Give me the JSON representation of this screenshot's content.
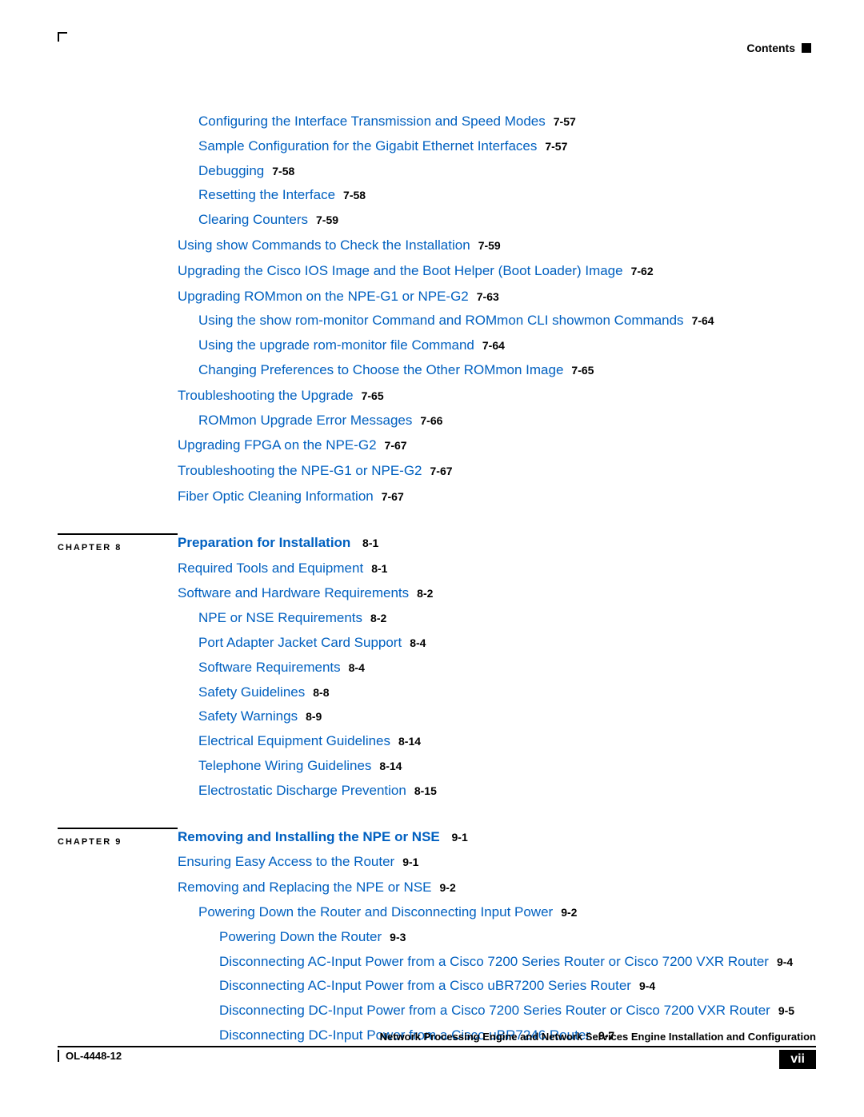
{
  "header": {
    "label": "Contents"
  },
  "section1": {
    "items": [
      {
        "indent": 1,
        "gap": false,
        "text": "Configuring the Interface Transmission and Speed Modes",
        "page": "7-57"
      },
      {
        "indent": 1,
        "gap": false,
        "text": "Sample Configuration for the Gigabit Ethernet Interfaces",
        "page": "7-57"
      },
      {
        "indent": 1,
        "gap": false,
        "text": "Debugging",
        "page": "7-58"
      },
      {
        "indent": 1,
        "gap": false,
        "text": "Resetting the Interface",
        "page": "7-58"
      },
      {
        "indent": 1,
        "gap": false,
        "text": "Clearing Counters",
        "page": "7-59"
      },
      {
        "indent": 0,
        "gap": true,
        "text": "Using show Commands to Check the Installation",
        "page": "7-59"
      },
      {
        "indent": 0,
        "gap": true,
        "text": "Upgrading the Cisco IOS Image and the Boot Helper (Boot Loader) Image",
        "page": "7-62"
      },
      {
        "indent": 0,
        "gap": true,
        "text": "Upgrading ROMmon on the NPE-G1 or NPE-G2",
        "page": "7-63"
      },
      {
        "indent": 1,
        "gap": false,
        "text": "Using the show rom-monitor Command and ROMmon CLI showmon Commands",
        "page": "7-64"
      },
      {
        "indent": 1,
        "gap": false,
        "text": "Using the upgrade rom-monitor file Command",
        "page": "7-64"
      },
      {
        "indent": 1,
        "gap": false,
        "text": "Changing Preferences to Choose the Other ROMmon Image",
        "page": "7-65"
      },
      {
        "indent": 0,
        "gap": true,
        "text": "Troubleshooting the Upgrade",
        "page": "7-65"
      },
      {
        "indent": 1,
        "gap": false,
        "text": "ROMmon Upgrade Error Messages",
        "page": "7-66"
      },
      {
        "indent": 0,
        "gap": true,
        "text": "Upgrading FPGA on the NPE-G2",
        "page": "7-67"
      },
      {
        "indent": 0,
        "gap": true,
        "text": "Troubleshooting the NPE-G1 or NPE-G2",
        "page": "7-67"
      },
      {
        "indent": 0,
        "gap": true,
        "text": "Fiber Optic Cleaning Information",
        "page": "7-67"
      }
    ]
  },
  "chapter8": {
    "chapter_label": "CHAPTER 8",
    "title": "Preparation for Installation",
    "title_page": "8-1",
    "items": [
      {
        "indent": 0,
        "gap": true,
        "text": "Required Tools and Equipment",
        "page": "8-1"
      },
      {
        "indent": 0,
        "gap": true,
        "text": "Software and Hardware Requirements",
        "page": "8-2"
      },
      {
        "indent": 1,
        "gap": false,
        "text": "NPE or NSE Requirements",
        "page": "8-2"
      },
      {
        "indent": 1,
        "gap": false,
        "text": "Port Adapter Jacket Card Support",
        "page": "8-4"
      },
      {
        "indent": 1,
        "gap": false,
        "text": "Software Requirements",
        "page": "8-4"
      },
      {
        "indent": 1,
        "gap": false,
        "text": "Safety Guidelines",
        "page": "8-8"
      },
      {
        "indent": 1,
        "gap": false,
        "text": "Safety Warnings",
        "page": "8-9"
      },
      {
        "indent": 1,
        "gap": false,
        "text": "Electrical Equipment Guidelines",
        "page": "8-14"
      },
      {
        "indent": 1,
        "gap": false,
        "text": "Telephone Wiring Guidelines",
        "page": "8-14"
      },
      {
        "indent": 1,
        "gap": false,
        "text": "Electrostatic Discharge Prevention",
        "page": "8-15"
      }
    ]
  },
  "chapter9": {
    "chapter_label": "CHAPTER 9",
    "title": "Removing and Installing the NPE or NSE",
    "title_page": "9-1",
    "items": [
      {
        "indent": 0,
        "gap": true,
        "text": "Ensuring Easy Access to the Router",
        "page": "9-1"
      },
      {
        "indent": 0,
        "gap": true,
        "text": "Removing and Replacing the NPE or NSE",
        "page": "9-2"
      },
      {
        "indent": 1,
        "gap": false,
        "text": "Powering Down the Router and Disconnecting Input Power",
        "page": "9-2"
      },
      {
        "indent": 2,
        "gap": false,
        "text": "Powering Down the Router",
        "page": "9-3"
      },
      {
        "indent": 2,
        "gap": false,
        "text": "Disconnecting AC-Input Power from a Cisco 7200 Series Router or Cisco 7200 VXR Router",
        "page": "9-4"
      },
      {
        "indent": 2,
        "gap": false,
        "text": "Disconnecting AC-Input Power from a Cisco uBR7200 Series Router",
        "page": "9-4"
      },
      {
        "indent": 2,
        "gap": false,
        "text": "Disconnecting DC-Input Power from a Cisco 7200 Series Router or Cisco 7200 VXR Router",
        "page": "9-5"
      },
      {
        "indent": 2,
        "gap": false,
        "text": "Disconnecting DC-Input Power from a Cisco uBR7246 Router",
        "page": "9-7"
      }
    ]
  },
  "footer": {
    "book_title": "Network Processing Engine and Network Services Engine Installation and Configuration",
    "doc_id": "OL-4448-12",
    "page_number": "vii"
  }
}
